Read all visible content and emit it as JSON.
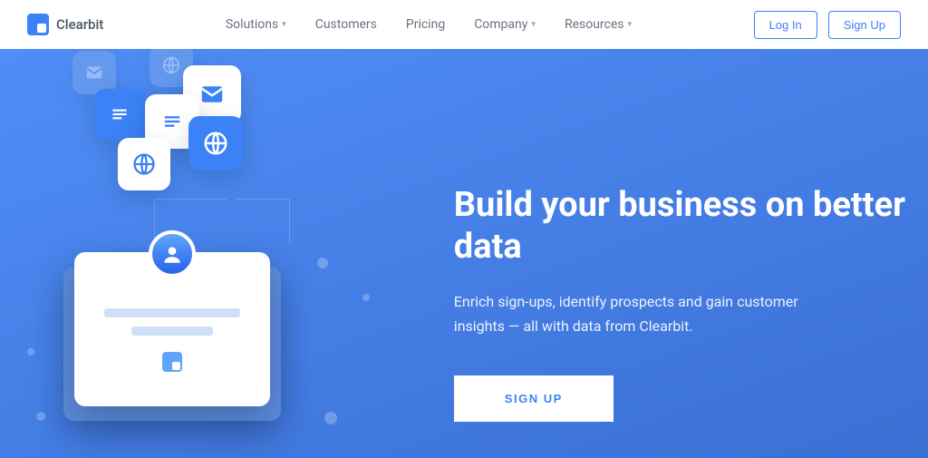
{
  "brand": "Clearbit",
  "nav": {
    "solutions": "Solutions",
    "customers": "Customers",
    "pricing": "Pricing",
    "company": "Company",
    "resources": "Resources"
  },
  "auth": {
    "login": "Log In",
    "signup": "Sign Up"
  },
  "hero": {
    "headline": "Build your business on better data",
    "subhead": "Enrich sign-ups, identify prospects and gain customer insights — all with data from Clearbit.",
    "cta": "SIGN UP"
  }
}
